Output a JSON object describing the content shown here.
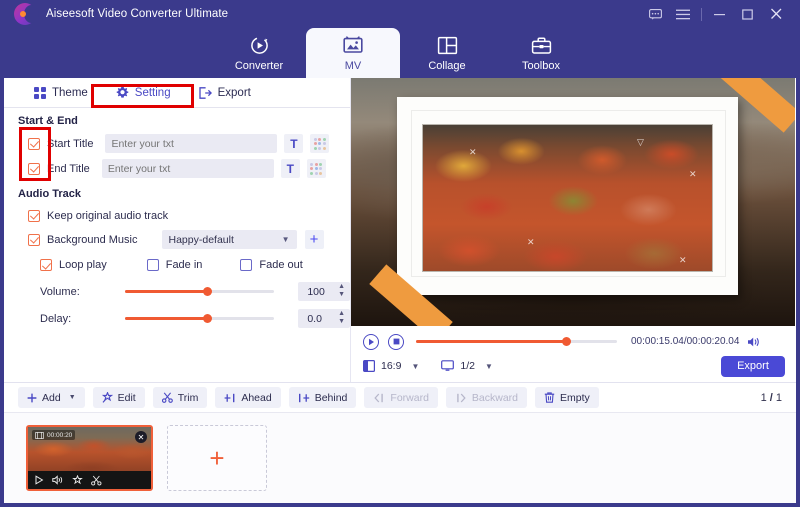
{
  "app": {
    "title": "Aiseesoft Video Converter Ultimate",
    "logo_icon": "aiseesoft-logo-icon"
  },
  "window_controls": [
    {
      "name": "feedback-icon",
      "glyph": "⬜"
    },
    {
      "name": "menu-icon",
      "glyph": "☰"
    },
    {
      "name": "minimize-icon",
      "glyph": "—"
    },
    {
      "name": "maximize-icon",
      "glyph": "□"
    },
    {
      "name": "close-icon",
      "glyph": "✕"
    }
  ],
  "nav_tabs": [
    {
      "label": "Converter",
      "icon": "converter-icon",
      "active": false
    },
    {
      "label": "MV",
      "icon": "mv-icon",
      "active": true
    },
    {
      "label": "Collage",
      "icon": "collage-icon",
      "active": false
    },
    {
      "label": "Toolbox",
      "icon": "toolbox-icon",
      "active": false
    }
  ],
  "sub_tabs": [
    {
      "label": "Theme",
      "icon": "theme-grid-icon",
      "active": false
    },
    {
      "label": "Setting",
      "icon": "gear-icon",
      "active": true
    },
    {
      "label": "Export",
      "icon": "export-icon",
      "active": false
    }
  ],
  "settings": {
    "start_end": {
      "section_label": "Start & End",
      "rows": [
        {
          "label": "Start Title",
          "checked": true,
          "value": "",
          "placeholder": "Enter your txt",
          "text_button": "T",
          "style_button": "text-style-grid-icon"
        },
        {
          "label": "End Title",
          "checked": true,
          "value": "",
          "placeholder": "Enter your txt",
          "text_button": "T",
          "style_button": "text-style-grid-icon"
        }
      ]
    },
    "audio_track": {
      "section_label": "Audio Track",
      "keep_original": {
        "label": "Keep original audio track",
        "checked": true
      },
      "background_music": {
        "label": "Background Music",
        "checked": true
      },
      "music_select": {
        "value": "Happy-default",
        "caret": "▼"
      },
      "add_music_button": "+",
      "toggles": [
        {
          "label": "Loop play",
          "checked": true
        },
        {
          "label": "Fade in",
          "checked": false
        },
        {
          "label": "Fade out",
          "checked": false
        }
      ],
      "volume": {
        "label": "Volume:",
        "value": "100",
        "percent": 55
      },
      "delay": {
        "label": "Delay:",
        "value": "0.0",
        "percent": 55
      }
    }
  },
  "preview": {
    "play_icon": "play-icon",
    "stop_icon": "stop-icon",
    "progress_percent": 75,
    "timecode": "00:00:15.04/00:00:20.04",
    "volume_icon": "speaker-icon",
    "aspect_ratio": {
      "icon": "aspect-ratio-icon",
      "value": "16:9",
      "caret": "▼"
    },
    "quality": {
      "icon": "monitor-icon",
      "value": "1/2",
      "caret": "▼"
    },
    "export_button": "Export"
  },
  "toolbar": {
    "buttons": [
      {
        "label": "Add",
        "icon": "plus-icon",
        "caret": "▼",
        "disabled": false
      },
      {
        "label": "Edit",
        "icon": "magic-wand-icon",
        "disabled": false
      },
      {
        "label": "Trim",
        "icon": "scissors-icon",
        "disabled": false
      },
      {
        "label": "Ahead",
        "icon": "insert-ahead-icon",
        "disabled": false
      },
      {
        "label": "Behind",
        "icon": "insert-behind-icon",
        "disabled": false
      },
      {
        "label": "Forward",
        "icon": "move-forward-icon",
        "disabled": true
      },
      {
        "label": "Backward",
        "icon": "move-backward-icon",
        "disabled": true
      },
      {
        "label": "Empty",
        "icon": "trash-icon",
        "disabled": false
      }
    ],
    "pager": {
      "current": "1",
      "separator": "/",
      "total": "1"
    }
  },
  "storyboard": {
    "clip": {
      "duration_badge": "00:00:20",
      "badge_icon": "film-icon",
      "close_icon": "close-icon",
      "tools": [
        {
          "name": "play-icon",
          "glyph": "▷"
        },
        {
          "name": "mute-icon",
          "glyph": "🔈"
        },
        {
          "name": "effect-icon",
          "glyph": "✦"
        },
        {
          "name": "trim-icon",
          "glyph": "✂"
        }
      ]
    },
    "add_tile": {
      "label": "+",
      "icon": "plus-icon"
    }
  },
  "colors": {
    "brand_purple": "#3b3a8c",
    "accent_blue": "#4a49d6",
    "accent_orange": "#f05a32",
    "annotation_red": "#e00000",
    "ribbon_orange": "#ef9b3f"
  }
}
